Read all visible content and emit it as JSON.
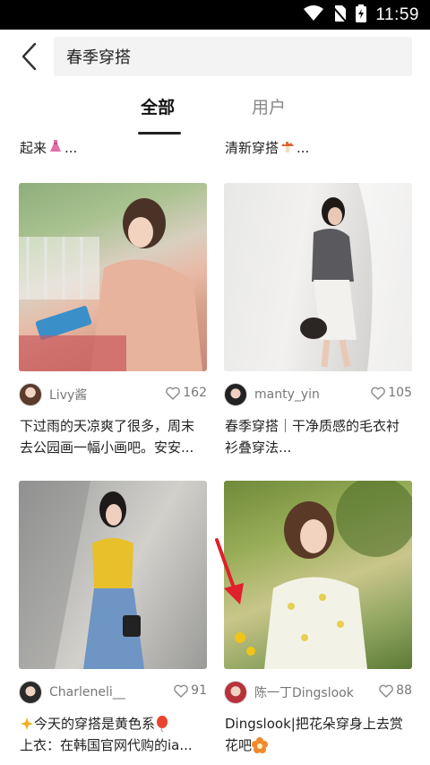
{
  "status_bar": {
    "time": "11:59",
    "icons": [
      "wifi-icon",
      "no-sim-icon",
      "battery-charging-icon"
    ]
  },
  "search": {
    "query": "春季穿搭"
  },
  "tabs": [
    {
      "label": "全部",
      "active": true
    },
    {
      "label": "用户",
      "active": false
    }
  ],
  "partial_above": [
    {
      "text": "起来",
      "emoji": "dress-emoji",
      "ellipsis": "..."
    },
    {
      "text": "清新穿搭",
      "emoji": "mushroom-emoji",
      "ellipsis": "..."
    }
  ],
  "posts": [
    {
      "author": "Livy酱",
      "likes": "162",
      "lines": [
        "下过雨的天凉爽了很多，周末",
        "去公园画一幅小画吧。安安..."
      ]
    },
    {
      "author": "manty_yin",
      "likes": "105",
      "lines": [
        "春季穿搭｜干净质感的毛衣衬",
        "衫叠穿法..."
      ]
    },
    {
      "author": "Charleneli__",
      "likes": "91",
      "lines": [
        "今天的穿搭是黄色系",
        "上衣：在韩国官网代购的ia..."
      ]
    },
    {
      "author": "陈一丁Dingslook",
      "likes": "88",
      "lines": [
        "Dingslook|把花朵穿身上去赏",
        "花吧"
      ]
    }
  ],
  "colors": {
    "status_bar": "#000000",
    "search_bg": "#f3f3f3",
    "accent_arrow": "#e0202a",
    "text_secondary": "#777777"
  }
}
